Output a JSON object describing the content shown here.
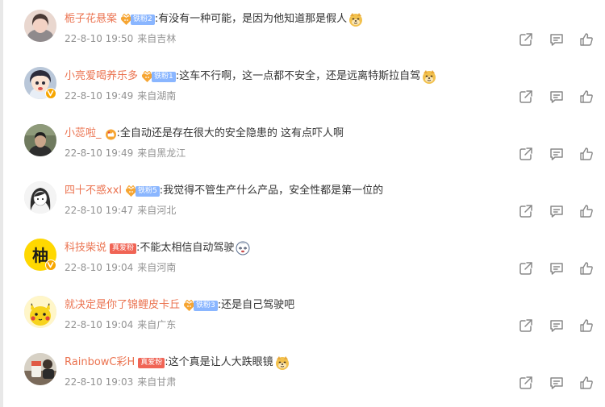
{
  "colors": {
    "username": "#eb7350",
    "meta": "#939393",
    "fan_badge": "#8ab6ff",
    "true_fan_badge": "#f06455",
    "verified": "#f7a600"
  },
  "comments": [
    {
      "username": "栀子花悬案",
      "badge_type": "fan",
      "badge_text": "铁粉2",
      "text": ":有没有一种可能，是因为他知道那是假人",
      "emoji": "doge-emoji",
      "date": "22-8-10 19:50",
      "location": "来自吉林",
      "verified": false,
      "avatar": "woman-avatar"
    },
    {
      "username": "小亮爱喝养乐多",
      "badge_type": "fan",
      "badge_text": "铁粉1",
      "text": ":这车不行啊，这一点都不安全，还是远离特斯拉自驾",
      "emoji": "doge-emoji",
      "date": "22-8-10 19:49",
      "location": "来自湖南",
      "verified": true,
      "avatar": "anime-avatar"
    },
    {
      "username": "小蕊啦_",
      "badge_type": "crown",
      "badge_text": "",
      "text": ":全自动还是存在很大的安全隐患的 这有点吓人啊",
      "emoji": "",
      "date": "22-8-10 19:49",
      "location": "来自黑龙江",
      "verified": false,
      "avatar": "person-avatar"
    },
    {
      "username": "四十不惑xxl",
      "badge_type": "fan",
      "badge_text": "铁粉5",
      "text": ":我觉得不管生产什么产品，安全性都是第一位的",
      "emoji": "",
      "date": "22-8-10 19:47",
      "location": "来自河北",
      "verified": false,
      "avatar": "sketch-girl-avatar"
    },
    {
      "username": "科技柴说",
      "badge_type": "true_fan",
      "badge_text": "真爱粉",
      "text": ":不能太相信自动驾驶",
      "emoji": "dizzy-emoji",
      "date": "22-8-10 19:04",
      "location": "来自河南",
      "verified": true,
      "avatar": "chai-logo-avatar",
      "avatar_text": "柚"
    },
    {
      "username": "就决定是你了锦鲤皮卡丘",
      "badge_type": "fan",
      "badge_text": "铁粉3",
      "text": ":还是自己驾驶吧",
      "emoji": "",
      "date": "22-8-10 19:04",
      "location": "来自广东",
      "verified": false,
      "avatar": "pikachu-avatar"
    },
    {
      "username": "RainbowC彩H",
      "badge_type": "true_fan",
      "badge_text": "真爱粉",
      "text": ":这个真是让人大跌眼镜",
      "emoji": "doge-emoji",
      "date": "22-8-10 19:03",
      "location": "来自甘肃",
      "verified": false,
      "avatar": "photo-avatar"
    }
  ]
}
